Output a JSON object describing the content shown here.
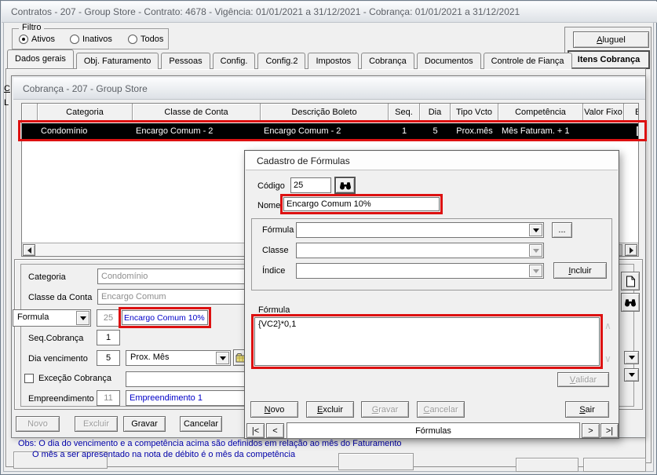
{
  "window": {
    "title": "Contratos - 207 - Group Store - Contrato: 4678 - Vigência: 01/01/2021 a 31/12/2021 - Cobrança: 01/01/2021 a 31/12/2021"
  },
  "filter": {
    "label": "Filtro",
    "ativos": "Ativos",
    "inativos": "Inativos",
    "todos": "Todos",
    "selected": "Ativos"
  },
  "tabs": [
    "Dados gerais",
    "Obj. Faturamento",
    "Pessoas",
    "Config.",
    "Config.2",
    "Impostos",
    "Cobrança",
    "Documentos",
    "Controle de Fiança"
  ],
  "active_tab": "Dados gerais",
  "right_panel": {
    "aluguel": "Aluguel",
    "itens_cobranca": "Itens Cobrança"
  },
  "edge_fragments": {
    "top": "C",
    "bottom": "L"
  },
  "cobranca_window": {
    "title": "Cobrança - 207 - Group Store",
    "table": {
      "columns": [
        "Categoria",
        "Classe de Conta",
        "Descrição Boleto",
        "Seq.",
        "Dia",
        "Tipo Vcto",
        "Competência",
        "Valor Fixo",
        "Ext"
      ],
      "rows": [
        {
          "categoria": "Condomínio",
          "classe_de_conta": "Encargo Comum - 2",
          "descricao_boleto": "Encargo Comum - 2",
          "seq": "1",
          "dia": "5",
          "tipo_vcto": "Prox.mês",
          "competencia": "Mês Faturam. + 1",
          "valor_fixo": ""
        }
      ]
    },
    "form": {
      "categoria_label": "Categoria",
      "categoria_value": "Condomínio",
      "classe_label": "Classe da Conta",
      "classe_value": "Encargo Comum",
      "formula_selector": "Formula",
      "formula_code": "25",
      "formula_name": "Encargo Comum 10%",
      "seq_label": "Seq.Cobrança",
      "seq_value": "1",
      "dia_label": "Dia vencimento",
      "dia_value": "5",
      "dia_tipo": "Prox. Mês",
      "excecao_label": "Exceção Cobrança",
      "excecao_value": "",
      "empreendimento_label": "Empreendimento",
      "empreendimento_code": "11",
      "empreendimento_value": "Empreendimento 1",
      "novo": "Novo",
      "excluir": "Excluir",
      "gravar": "Gravar",
      "cancelar": "Cancelar"
    }
  },
  "dialog": {
    "title": "Cadastro de Fórmulas",
    "codigo_label": "Código",
    "codigo_value": "25",
    "nome_label": "Nome",
    "nome_value": "Encargo Comum 10%",
    "formula_label": "Fórmula",
    "formula_value": "",
    "classe_label": "Classe",
    "classe_value": "",
    "indice_label": "Índice",
    "indice_value": "",
    "browse": "...",
    "incluir": "Incluir",
    "formula_box_label": "Fórmula",
    "formula_text": "{VC2}*0,1",
    "validar": "Validar",
    "novo": "Novo",
    "excluir": "Excluir",
    "gravar": "Gravar",
    "cancelar": "Cancelar",
    "sair": "Sair",
    "nav": {
      "first": "|<",
      "prev": "<",
      "caption": "Fórmulas",
      "next": ">",
      "last": ">|"
    }
  },
  "obs": {
    "line1": "Obs: O dia do vencimento e a competência acima são definidos em relação ao mês do Faturamento",
    "line2": "O mês a ser apresentado na nota de débito é o mês da competência"
  },
  "colors": {
    "highlight_red": "#dd1111",
    "row_selected_bg": "#000000",
    "value_blue": "#0000c8",
    "obs_blue": "#0000a8"
  }
}
